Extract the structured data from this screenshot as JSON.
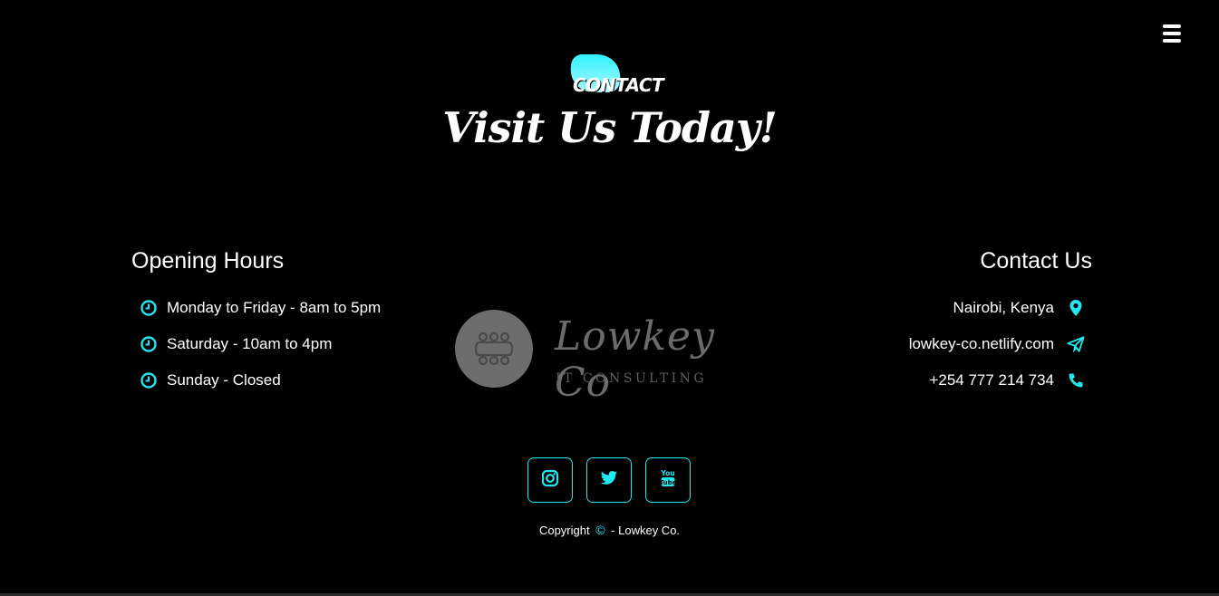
{
  "header": {
    "eyebrow": "CONTACT",
    "headline": "Visit Us Today!"
  },
  "menu": {
    "icon": "hamburger-menu-icon"
  },
  "opening_hours": {
    "title": "Opening Hours",
    "items": [
      {
        "icon": "clock-icon",
        "text": "Monday to Friday - 8am to 5pm"
      },
      {
        "icon": "clock-icon",
        "text": "Saturday - 10am to 4pm"
      },
      {
        "icon": "clock-icon",
        "text": "Sunday - Closed"
      }
    ]
  },
  "contact_us": {
    "title": "Contact Us",
    "items": [
      {
        "icon": "map-pin-icon",
        "text": "Nairobi, Kenya"
      },
      {
        "icon": "paper-plane-icon",
        "text": "lowkey-co.netlify.com"
      },
      {
        "icon": "phone-icon",
        "text": "+254 777 214 734"
      }
    ]
  },
  "logo": {
    "name": "Lowkey Co",
    "subtitle": "IT CONSULTING"
  },
  "socials": [
    {
      "icon": "instagram-icon"
    },
    {
      "icon": "twitter-icon"
    },
    {
      "icon": "youtube-icon"
    }
  ],
  "footer": {
    "copyright_prefix": "Copyright",
    "copyright_symbol": "©",
    "copyright_suffix": "- Lowkey Co."
  },
  "colors": {
    "accent": "#22e6f0",
    "background": "#000000",
    "text": "#ffffff",
    "logo_gray": "#6b6b6b"
  }
}
